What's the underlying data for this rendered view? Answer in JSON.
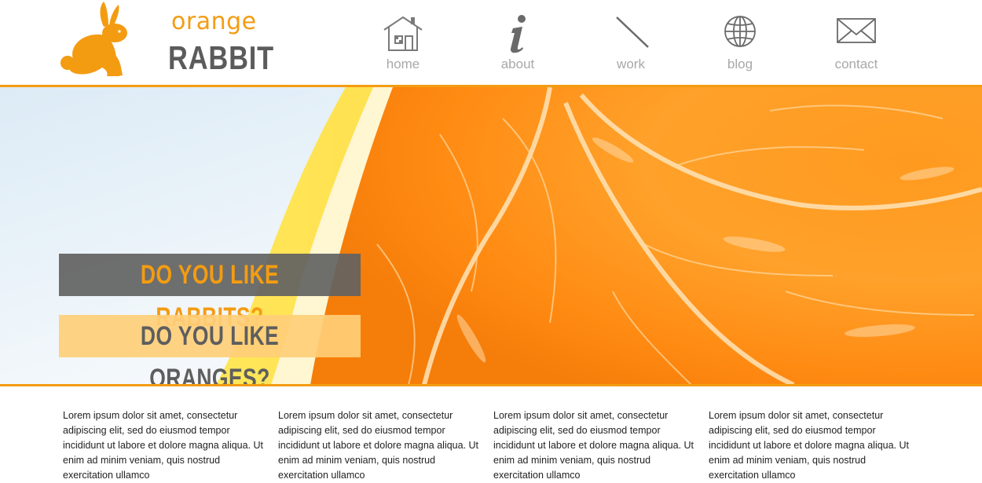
{
  "logo": {
    "word_top": "orange",
    "word_bottom": "RABBIT"
  },
  "nav": {
    "items": [
      {
        "label": "home",
        "icon": "home-icon"
      },
      {
        "label": "about",
        "icon": "info-icon"
      },
      {
        "label": "work",
        "icon": "pencil-line-icon"
      },
      {
        "label": "blog",
        "icon": "globe-icon"
      },
      {
        "label": "contact",
        "icon": "envelope-icon"
      }
    ]
  },
  "hero": {
    "banner_1": "DO YOU LIKE RABBITS?",
    "banner_2": "DO YOU LIKE ORANGES?"
  },
  "columns": [
    {
      "text": "Lorem ipsum dolor sit amet, consectetur adipiscing elit, sed do eiusmod tempor incididunt ut labore et dolore magna aliqua. Ut enim ad minim veniam, quis nostrud exercitation ullamco"
    },
    {
      "text": "Lorem ipsum dolor sit amet, consectetur adipiscing elit, sed do eiusmod tempor incididunt ut labore et dolore magna aliqua. Ut enim ad minim veniam, quis nostrud exercitation ullamco"
    },
    {
      "text": "Lorem ipsum dolor sit amet, consectetur adipiscing elit, sed do eiusmod tempor incididunt ut labore et dolore magna aliqua. Ut enim ad minim veniam, quis nostrud exercitation ullamco"
    },
    {
      "text": "Lorem ipsum dolor sit amet, consectetur adipiscing elit, sed do eiusmod tempor incididunt ut labore et dolore magna aliqua. Ut enim ad minim veniam, quis nostrud exercitation ullamco"
    }
  ],
  "colors": {
    "accent": "#f39c12",
    "text_dark": "#5b5b5b",
    "nav_text": "#a8a8a8"
  }
}
